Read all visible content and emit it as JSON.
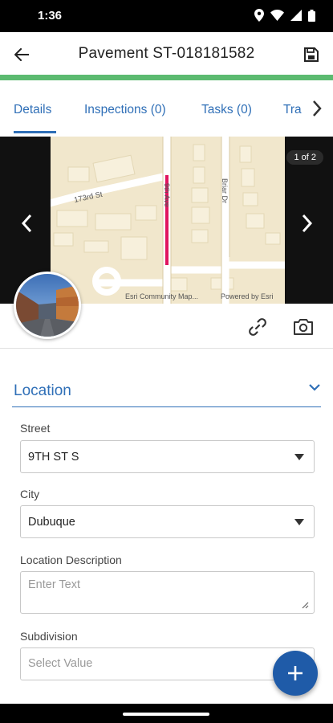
{
  "status_bar": {
    "time": "1:36",
    "icons": [
      "location-icon",
      "wifi-icon",
      "signal-icon",
      "battery-icon"
    ]
  },
  "header": {
    "title": "Pavement ST-018181582",
    "back_icon": "arrow-left-icon",
    "save_icon": "save-icon",
    "progress_color": "#5cba70"
  },
  "tabs": {
    "items": [
      {
        "label": "Details",
        "active": true
      },
      {
        "label": "Inspections (0)",
        "active": false
      },
      {
        "label": "Tasks (0)",
        "active": false
      },
      {
        "label": "Tra",
        "active": false
      }
    ],
    "more_icon": "chevron-right-icon",
    "accent_color": "#2f6fb7"
  },
  "map": {
    "counter": "1 of 2",
    "street_labels": [
      "173rd St",
      "9th Ave",
      "Briar Dr"
    ],
    "attribution_left": "Esri Community Map...",
    "attribution_right": "Powered by Esri",
    "highlight_color": "#e0145f"
  },
  "actions": {
    "link_icon": "link-icon",
    "camera_icon": "camera-icon"
  },
  "section": {
    "title": "Location",
    "expanded": true
  },
  "fields": {
    "street": {
      "label": "Street",
      "value": "9TH ST S"
    },
    "city": {
      "label": "City",
      "value": "Dubuque"
    },
    "location_description": {
      "label": "Location Description",
      "placeholder": "Enter Text"
    },
    "subdivision": {
      "label": "Subdivision",
      "placeholder": "Select Value"
    }
  },
  "fab": {
    "icon": "plus-icon",
    "color": "#1f5ba8"
  }
}
